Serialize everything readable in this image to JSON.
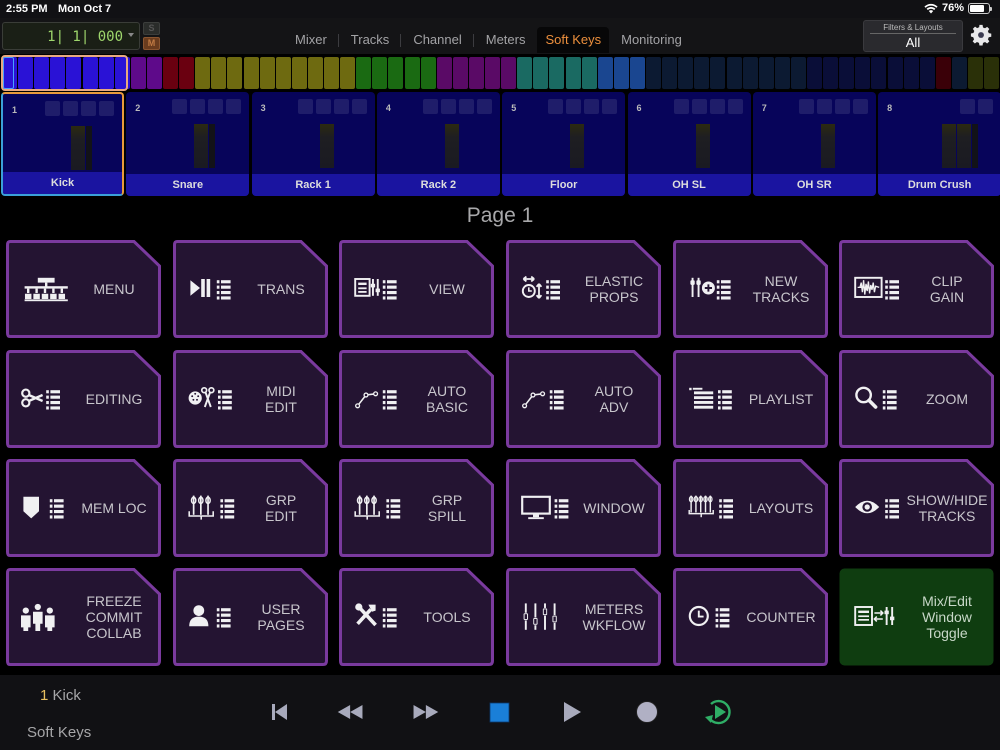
{
  "status_bar": {
    "time": "2:55 PM",
    "date": "Mon Oct 7",
    "battery_percent": "76%",
    "battery_level": 0.76,
    "wifi_icon": "wifi-icon"
  },
  "header": {
    "counter_value": "1| 1| 000",
    "solo_label": "S",
    "mute_label": "M",
    "tabs": [
      {
        "label": "Mixer",
        "active": false
      },
      {
        "label": "Tracks",
        "active": false
      },
      {
        "label": "Channel",
        "active": false
      },
      {
        "label": "Meters",
        "active": false
      },
      {
        "label": "Soft Keys",
        "active": true
      },
      {
        "label": "Monitoring",
        "active": false
      }
    ],
    "filters_label": "Filters & Layouts",
    "filters_value": "All",
    "settings_icon": "gear-icon"
  },
  "colors": {
    "accent_orange": "#ec8f3d",
    "key_fill": "#241432",
    "key_border": "#7a3a9e",
    "green_key_fill": "#0f3d10",
    "track_blue": "#07045a"
  },
  "track_strip": [
    "#2a12d6",
    "#2a12d6",
    "#2a12d6",
    "#2a12d6",
    "#2a12d6",
    "#2a12d6",
    "#2a12d6",
    "#2a12d6",
    "#5e0a8a",
    "#5e0a8a",
    "#6a0010",
    "#6a0010",
    "#6e6a10",
    "#6e6a10",
    "#6e6a10",
    "#6e6a10",
    "#6e6a10",
    "#6e6a10",
    "#6e6a10",
    "#6e6a10",
    "#6e6a10",
    "#6e6a10",
    "#1a6a12",
    "#1a6a12",
    "#1a6a12",
    "#1a6a12",
    "#1a6a12",
    "#5a0a66",
    "#5a0a66",
    "#5a0a66",
    "#5a0a66",
    "#5a0a66",
    "#1a6a62",
    "#1a6a62",
    "#1a6a62",
    "#1a6a62",
    "#1a6a62",
    "#1a4690",
    "#1a4690",
    "#1a4690",
    "#0c1a32",
    "#0c1a32",
    "#0c1a32",
    "#0c1a32",
    "#0c1a32",
    "#0c1a32",
    "#0c1a32",
    "#0c1a32",
    "#0c1a32",
    "#0c1a32",
    "#0a0e38",
    "#0a0e38",
    "#0a0e38",
    "#0a0e38",
    "#0a0e38",
    "#0a0e38",
    "#0a0e38",
    "#0a0e38",
    "#3a0008",
    "#0c1a32",
    "#2a3008",
    "#2a3008"
  ],
  "channels": [
    {
      "num": "1",
      "name": "Kick",
      "inserts": 4,
      "meters": 2,
      "selected": true
    },
    {
      "num": "2",
      "name": "Snare",
      "inserts": 4,
      "meters": 2,
      "selected": false
    },
    {
      "num": "3",
      "name": "Rack 1",
      "inserts": 4,
      "meters": 1,
      "selected": false
    },
    {
      "num": "4",
      "name": "Rack 2",
      "inserts": 4,
      "meters": 1,
      "selected": false
    },
    {
      "num": "5",
      "name": "Floor",
      "inserts": 4,
      "meters": 1,
      "selected": false
    },
    {
      "num": "6",
      "name": "OH SL",
      "inserts": 4,
      "meters": 1,
      "selected": false
    },
    {
      "num": "7",
      "name": "OH SR",
      "inserts": 4,
      "meters": 1,
      "selected": false
    },
    {
      "num": "8",
      "name": "Drum Crush",
      "inserts": 2,
      "meters": 3,
      "selected": false
    }
  ],
  "page_title": "Page 1",
  "soft_keys": [
    {
      "label": "MENU",
      "icon": "menu-tree-icon"
    },
    {
      "label": "TRANS",
      "icon": "transport-list-icon"
    },
    {
      "label": "VIEW",
      "icon": "view-list-icon"
    },
    {
      "label": "ELASTIC\nPROPS",
      "icon": "elastic-list-icon"
    },
    {
      "label": "NEW\nTRACKS",
      "icon": "new-tracks-list-icon"
    },
    {
      "label": "CLIP\nGAIN",
      "icon": "clip-gain-list-icon"
    },
    {
      "label": "EDITING",
      "icon": "scissors-list-icon"
    },
    {
      "label": "MIDI\nEDIT",
      "icon": "midi-edit-list-icon"
    },
    {
      "label": "AUTO\nBASIC",
      "icon": "automation-list-icon"
    },
    {
      "label": "AUTO\nADV",
      "icon": "automation-adv-list-icon"
    },
    {
      "label": "PLAYLIST",
      "icon": "playlist-list-icon"
    },
    {
      "label": "ZOOM",
      "icon": "zoom-list-icon"
    },
    {
      "label": "MEM LOC",
      "icon": "memory-location-list-icon"
    },
    {
      "label": "GRP\nEDIT",
      "icon": "group-edit-list-icon"
    },
    {
      "label": "GRP\nSPILL",
      "icon": "group-spill-list-icon"
    },
    {
      "label": "WINDOW",
      "icon": "window-list-icon"
    },
    {
      "label": "LAYOUTS",
      "icon": "layouts-list-icon"
    },
    {
      "label": "SHOW/HIDE\nTRACKS",
      "icon": "eye-list-icon"
    },
    {
      "label": "FREEZE\nCOMMIT\nCOLLAB",
      "icon": "people-icon"
    },
    {
      "label": "USER\nPAGES",
      "icon": "user-list-icon"
    },
    {
      "label": "TOOLS",
      "icon": "tools-list-icon"
    },
    {
      "label": "METERS\nWKFLOW",
      "icon": "faders-icon"
    },
    {
      "label": "COUNTER",
      "icon": "clock-list-icon"
    },
    {
      "label": "Mix/Edit\nWindow\nToggle",
      "icon": "mix-edit-toggle-icon",
      "green": true
    }
  ],
  "bottom": {
    "selected_track_num": "1",
    "selected_track_name": "Kick",
    "mode_label": "Soft Keys",
    "transport": [
      {
        "name": "return-to-zero-button",
        "icon": "rtz-icon"
      },
      {
        "name": "rewind-button",
        "icon": "rewind-icon"
      },
      {
        "name": "fast-forward-button",
        "icon": "fast-forward-icon"
      },
      {
        "name": "stop-button",
        "icon": "stop-icon"
      },
      {
        "name": "play-button",
        "icon": "play-icon"
      },
      {
        "name": "record-button",
        "icon": "record-icon"
      },
      {
        "name": "loop-play-button",
        "icon": "loop-play-icon"
      }
    ]
  }
}
